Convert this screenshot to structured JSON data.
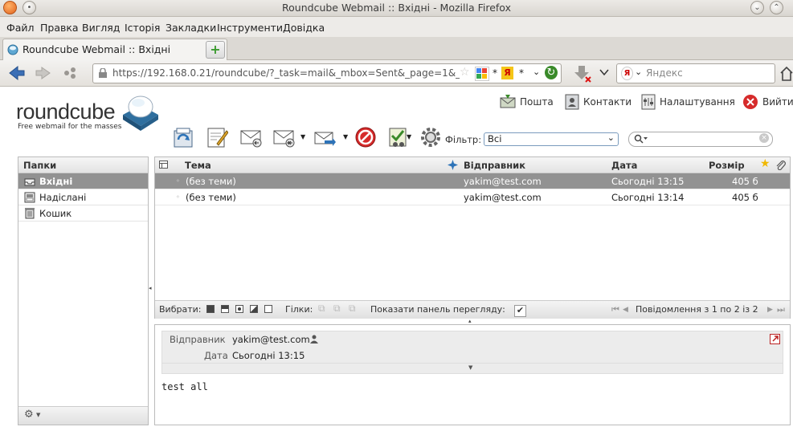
{
  "window": {
    "title": "Roundcube Webmail :: Вхідні - Mozilla Firefox"
  },
  "menubar": {
    "items": [
      "Файл",
      "Правка",
      "Вигляд",
      "Історія",
      "Закладки",
      "Інструменти",
      "Довідка"
    ]
  },
  "tab": {
    "label": "Roundcube Webmail :: Вхідні"
  },
  "navbar": {
    "url": "https://192.168.0.21/roundcube/?_task=mail&_mbox=Sent&_page=1&_refres",
    "search_placeholder": "Яндекс"
  },
  "app": {
    "logo": "roundcube",
    "tagline": "Free webmail for the masses",
    "topnav": {
      "mail": "Пошта",
      "contacts": "Контакти",
      "settings": "Налаштування",
      "logout": "Вийти"
    },
    "filter_label": "Фільтр:",
    "filter_value": "Всі"
  },
  "folders": {
    "header": "Папки",
    "items": [
      {
        "name": "Вхідні",
        "selected": true
      },
      {
        "name": "Надіслані",
        "selected": false
      },
      {
        "name": "Кошик",
        "selected": false
      }
    ]
  },
  "messagelist": {
    "columns": {
      "subject": "Тема",
      "from": "Відправник",
      "date": "Дата",
      "size": "Розмір"
    },
    "rows": [
      {
        "subject": "(без теми)",
        "from": "yakim@test.com",
        "date": "Сьогодні 13:15",
        "size": "405 б",
        "selected": true
      },
      {
        "subject": "(без теми)",
        "from": "yakim@test.com",
        "date": "Сьогодні 13:14",
        "size": "405 б",
        "selected": false
      }
    ],
    "footer": {
      "select_label": "Вибрати:",
      "threads_label": "Гілки:",
      "preview_label": "Показати панель перегляду:",
      "count_text": "Повідомлення з 1 по 2 із 2"
    }
  },
  "preview": {
    "from_label": "Відправник",
    "from_value": "yakim@test.com",
    "date_label": "Дата",
    "date_value": "Сьогодні 13:15",
    "body": "test all"
  }
}
